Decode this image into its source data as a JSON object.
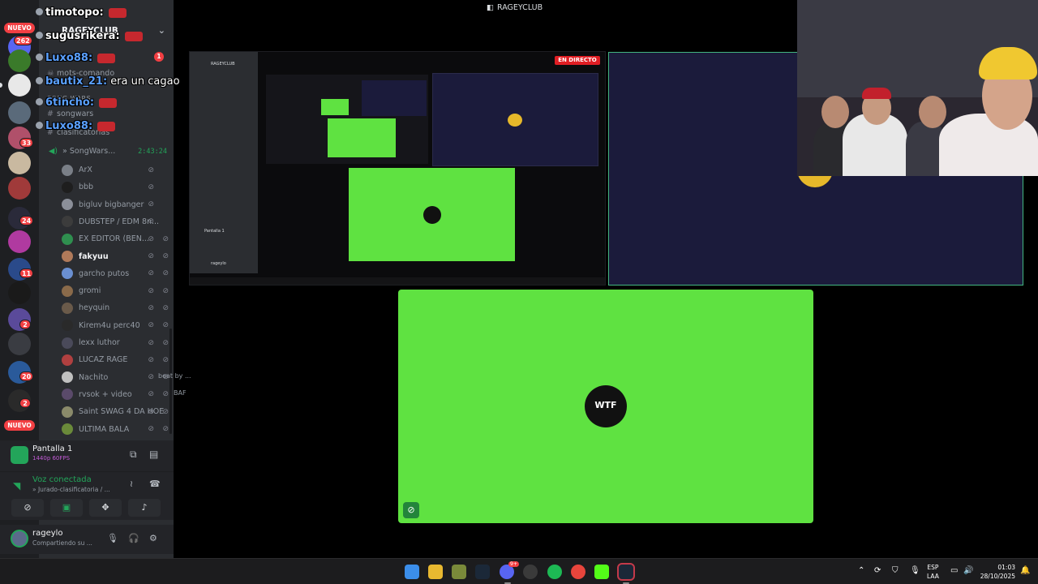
{
  "server": {
    "name": "RAGEYCLUB",
    "new_badge_top": "NUEVO",
    "new_badge_bottom": "NUEVO",
    "rail_badges": [
      "262",
      "33",
      "24",
      "11",
      "2",
      "20",
      "2"
    ]
  },
  "channels": {
    "items": [
      "mots-comando",
      "SONG WARS",
      "songwars",
      "clasificatorias"
    ],
    "mention_count": "1"
  },
  "voice_channel": {
    "name": "» SongWars...",
    "time": "2:43:24"
  },
  "members": [
    {
      "name": "ArX",
      "color": "#7a7f87"
    },
    {
      "name": "bbb",
      "color": "#1e1e1e"
    },
    {
      "name": "bigluv bigbanger",
      "color": "#8b8f99"
    },
    {
      "name": "DUBSTEP / EDM 8n...",
      "color": "#3c3c3c"
    },
    {
      "name": "EX EDITOR (BEN...",
      "color": "#2f8f4f"
    },
    {
      "name": "fakyuu",
      "color": "#b07a5a"
    },
    {
      "name": "garcho putos",
      "color": "#6a8fd1"
    },
    {
      "name": "gromi",
      "color": "#8a6a4a"
    },
    {
      "name": "heyquin",
      "color": "#6a5a4a"
    },
    {
      "name": "Kirem4u perc40",
      "color": "#2a2a2a"
    },
    {
      "name": "lexx luthor",
      "color": "#4a4a5a"
    },
    {
      "name": "LUCAZ RAGE",
      "color": "#b04040"
    },
    {
      "name": "Nachito",
      "color": "#c0c0c0"
    },
    {
      "name": "rvsok + video",
      "color": "#5a4a6a"
    },
    {
      "name": "Saint SWAG 4 DA HOE",
      "color": "#8a8a6a"
    },
    {
      "name": "ULTIMA BALA",
      "color": "#6a8a3a"
    }
  ],
  "member_extras": {
    "nachito_tail": "beat by ...",
    "rvsok_tail": "BAF"
  },
  "stream_panel": {
    "title": "Pantalla 1",
    "subtitle": "1440p 60FPS"
  },
  "voice_panel": {
    "status": "Voz conectada",
    "channel": "» Jurado-clasificatoria / ..."
  },
  "user": {
    "name": "rageylo",
    "status": "Compartiendo su ..."
  },
  "chat": [
    {
      "user": "timotopo:",
      "color": "#ffffff",
      "msg": ""
    },
    {
      "user": "sugusrikera:",
      "color": "#ffffff",
      "msg": ""
    },
    {
      "user": "Luxo88:",
      "color": "#5aa0ff",
      "msg": ""
    },
    {
      "user": "bautix_21:",
      "color": "#5aa0ff",
      "msg": "era un cagao"
    },
    {
      "user": "6tincho:",
      "color": "#5aa0ff",
      "msg": ""
    },
    {
      "user": "Luxo88:",
      "color": "#5aa0ff",
      "msg": ""
    }
  ],
  "stage": {
    "title": "RAGEYCLUB",
    "live_label": "EN DIRECTO",
    "logo_text": "WTF"
  },
  "nested": {
    "server_name": "RAGEYCLUB",
    "user_name": "rageylo",
    "pantalla": "Pantalla 1"
  },
  "taskbar": {
    "lang_top": "ESP",
    "lang_bottom": "LAA",
    "time": "01:03",
    "date": "28/10/2025",
    "discord_badge": "9+"
  },
  "colors": {
    "accent_green": "#23a55a",
    "stream_green": "#5fe241",
    "live_red": "#e01e24",
    "tile_navy": "#1b1b3b"
  }
}
